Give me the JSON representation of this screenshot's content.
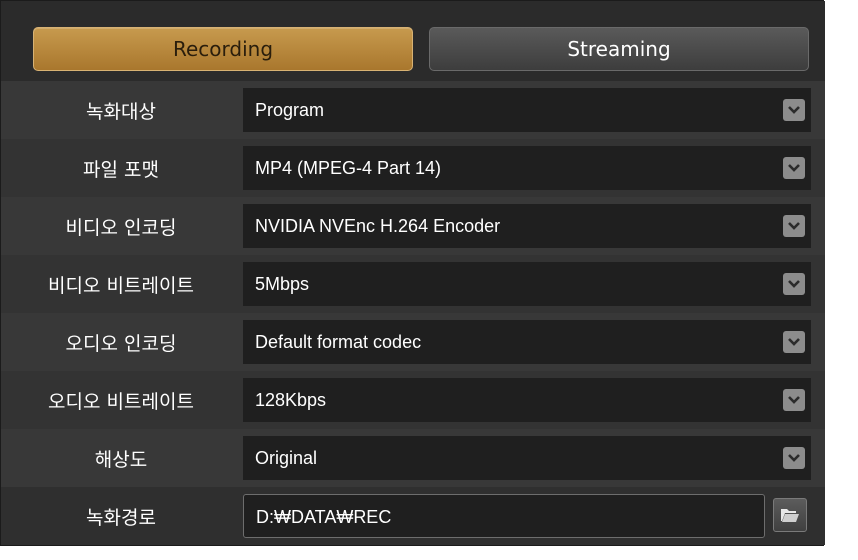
{
  "tabs": {
    "recording_label": "Recording",
    "streaming_label": "Streaming"
  },
  "rows": [
    {
      "label": "녹화대상",
      "value": "Program",
      "control": "dropdown"
    },
    {
      "label": "파일 포맷",
      "value": "MP4 (MPEG-4 Part 14)",
      "control": "dropdown"
    },
    {
      "label": "비디오 인코딩",
      "value": "NVIDIA NVEnc H.264 Encoder",
      "control": "dropdown"
    },
    {
      "label": "비디오 비트레이트",
      "value": "5Mbps",
      "control": "dropdown"
    },
    {
      "label": "오디오 인코딩",
      "value": "Default format codec",
      "control": "dropdown"
    },
    {
      "label": "오디오 비트레이트",
      "value": "128Kbps",
      "control": "dropdown"
    },
    {
      "label": "해상도",
      "value": "Original",
      "control": "dropdown"
    },
    {
      "label": "녹화경로",
      "value": "D:₩DATA₩REC",
      "control": "folder-browse"
    }
  ],
  "icons": {
    "dropdown": "chevron-down-icon",
    "browse": "folder-open-icon"
  },
  "colors": {
    "active_tab": "#b98738",
    "panel_bg": "#2b2b2b",
    "field_bg": "#1f1f1f",
    "text": "#ffffff"
  }
}
